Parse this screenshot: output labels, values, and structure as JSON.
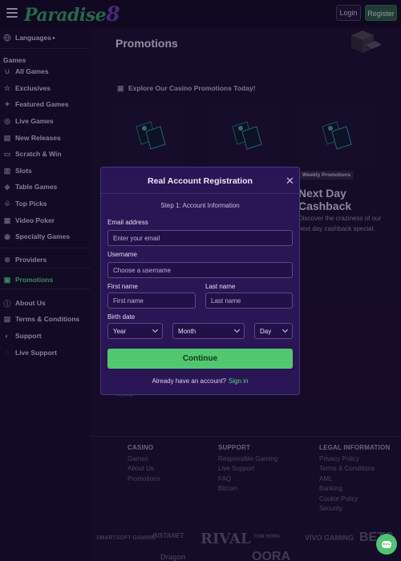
{
  "header": {
    "logo_text": "Paradise",
    "logo_suffix": "8",
    "login_label": "Login",
    "register_label": "Register"
  },
  "sidebar": {
    "languages_label": "Languages",
    "games_header": "Games",
    "items": [
      {
        "label": "All Games",
        "icon": "horseshoe-icon"
      },
      {
        "label": "Exclusives",
        "icon": "star-icon"
      },
      {
        "label": "Featured Games",
        "icon": "puzzle-icon"
      },
      {
        "label": "Live Games",
        "icon": "chip-icon"
      },
      {
        "label": "New Releases",
        "icon": "new-icon"
      },
      {
        "label": "Scratch & Win",
        "icon": "ticket-icon"
      },
      {
        "label": "Slots",
        "icon": "slot-icon"
      },
      {
        "label": "Table Games",
        "icon": "table-icon"
      },
      {
        "label": "Top Picks",
        "icon": "thumb-icon"
      },
      {
        "label": "Video Poker",
        "icon": "cards-icon"
      },
      {
        "label": "Specialty Games",
        "icon": "dice-icon"
      }
    ],
    "providers_label": "Providers",
    "promotions_label": "Promotions",
    "bottom_items": [
      {
        "label": "About Us",
        "icon": "info-icon"
      },
      {
        "label": "Terms & Conditions",
        "icon": "document-icon"
      },
      {
        "label": "Support",
        "icon": "headset-icon"
      },
      {
        "label": "Live Support",
        "icon": "chat-icon"
      }
    ]
  },
  "main": {
    "page_title": "Promotions",
    "explore_heading": "Explore Our Casino Promotions Today!",
    "badge": "Weekly Promotions",
    "card_title": "Next Day Cashback",
    "card_desc": "Discover the craziness of our next day cashback special.",
    "loyalty_fragment": "loyalty."
  },
  "modal": {
    "title": "Real Account Registration",
    "step": "Step 1: Account Information",
    "email_label": "Email address",
    "email_placeholder": "Enter your email",
    "username_label": "Username",
    "username_placeholder": "Choose a username",
    "first_name_label": "First name",
    "first_name_placeholder": "First name",
    "last_name_label": "Last name",
    "last_name_placeholder": "Last name",
    "birth_label": "Birth date",
    "year_label": "Year",
    "month_label": "Month",
    "day_label": "Day",
    "continue_label": "Continue",
    "have_account": "Already have an account?",
    "signin_label": "Sign in"
  },
  "footer": {
    "casino": {
      "header": "CASINO",
      "links": [
        "Games",
        "About Us",
        "Promotions"
      ]
    },
    "support": {
      "header": "SUPPORT",
      "links": [
        "Responsible Gaming",
        "Live Support",
        "FAQ",
        "Bitcoin"
      ]
    },
    "legal": {
      "header": "LEGAL INFORMATION",
      "links": [
        "Privacy Policy",
        "Terms & Conditions",
        "AML",
        "Banking",
        "Cookie Policy",
        "Security"
      ]
    },
    "partners": [
      "SMARTSOFT GAMING",
      "INSTANET",
      "RIVAL",
      "TOM HORN",
      "VIVO GAMING",
      "BETS",
      "Dragon",
      "OORA"
    ]
  },
  "colors": {
    "accent_green": "#51c86f",
    "modal_bg": "#2a1655",
    "page_bg": "#1c1035"
  }
}
